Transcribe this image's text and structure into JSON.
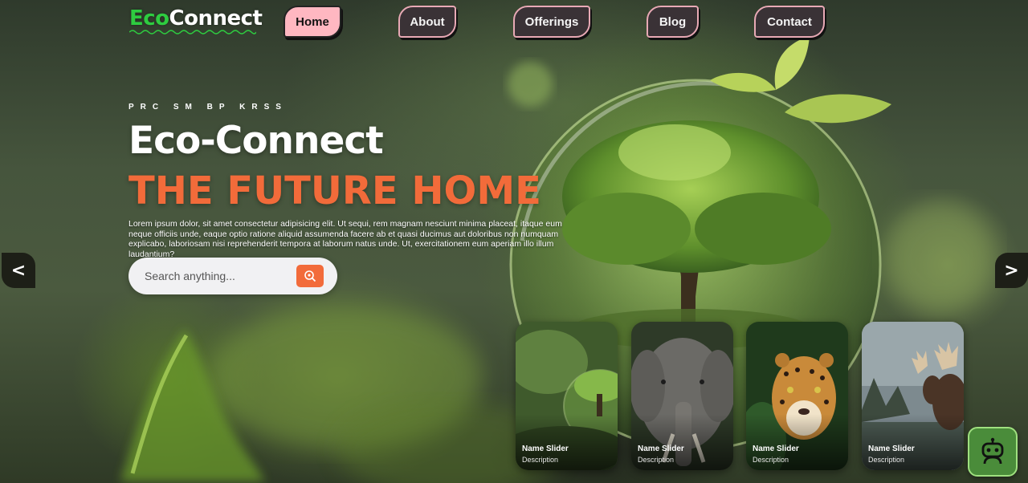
{
  "brand": {
    "part1": "Eco",
    "part2": "Connect"
  },
  "nav": [
    {
      "label": "Home",
      "active": true
    },
    {
      "label": "About",
      "active": false
    },
    {
      "label": "Offerings",
      "active": false
    },
    {
      "label": "Blog",
      "active": false
    },
    {
      "label": "Contact",
      "active": false
    }
  ],
  "hero": {
    "kicker": "PRC SM BP KRSS",
    "title": "Eco-Connect",
    "subtitle": "THE FUTURE HOME",
    "description": "Lorem ipsum dolor, sit amet consectetur adipisicing elit. Ut sequi, rem magnam nesciunt minima placeat, itaque eum neque officiis unde, eaque optio ratione aliquid assumenda facere ab et quasi ducimus aut doloribus non numquam explicabo, laboriosam nisi reprehenderit tempora at laborum natus unde. Ut, exercitationem eum aperiam illo illum laudantium?"
  },
  "search": {
    "placeholder": "Search anything...",
    "button_icon": "search-icon"
  },
  "slider": {
    "prev_label": "<",
    "next_label": ">",
    "cards": [
      {
        "name": "Name Slider",
        "description": "Description",
        "subject": "earth-globe-tree"
      },
      {
        "name": "Name Slider",
        "description": "Description",
        "subject": "elephant"
      },
      {
        "name": "Name Slider",
        "description": "Description",
        "subject": "leopard"
      },
      {
        "name": "Name Slider",
        "description": "Description",
        "subject": "moose"
      }
    ]
  },
  "chatbot": {
    "icon": "robot-icon"
  },
  "colors": {
    "accent_orange": "#f26b3a",
    "brand_green": "#2ecc40",
    "nav_active_bg": "#ffb7c1",
    "nav_bg": "#3a3236",
    "nav_border": "#e8a9b5"
  }
}
